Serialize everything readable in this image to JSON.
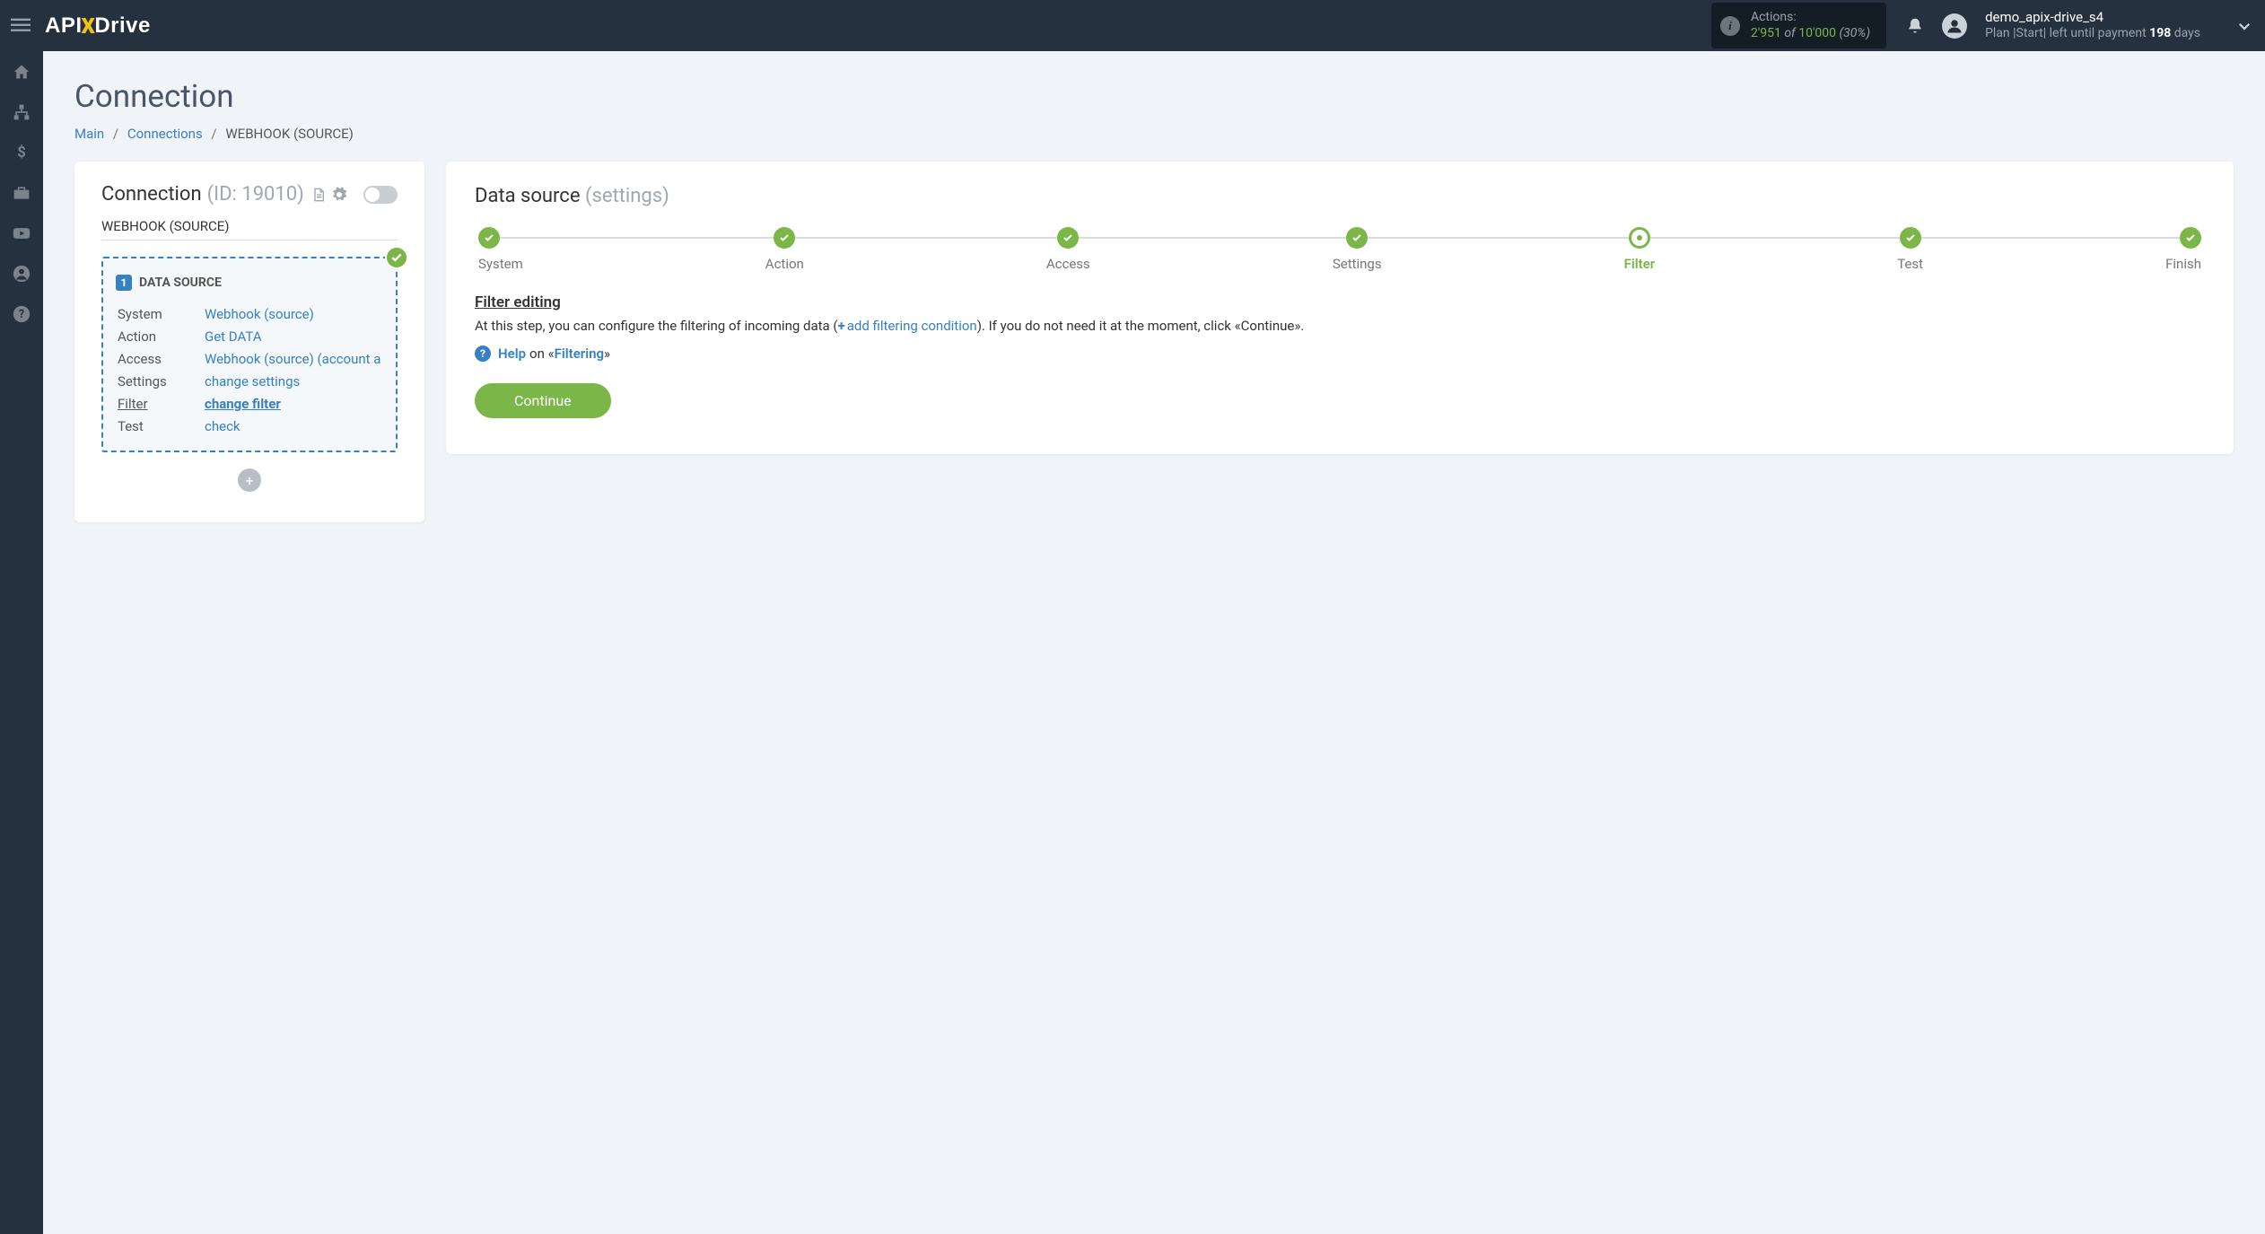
{
  "header": {
    "actions_label": "Actions:",
    "actions_used": "2'951",
    "actions_of": " of ",
    "actions_total": "10'000",
    "actions_pct": " (30%)",
    "username": "demo_apix-drive_s4",
    "plan_prefix": "Plan |Start| left until payment ",
    "plan_days": "198",
    "plan_suffix": " days"
  },
  "page": {
    "title": "Connection",
    "crumb_main": "Main",
    "crumb_conn": "Connections",
    "crumb_current": "WEBHOOK (SOURCE)"
  },
  "conn_card": {
    "title": "Connection",
    "id_label": "(ID: 19010)",
    "subtitle": "WEBHOOK (SOURCE)",
    "box_title": "DATA SOURCE",
    "rows": [
      {
        "label": "System",
        "value": "Webhook (source)"
      },
      {
        "label": "Action",
        "value": "Get DATA"
      },
      {
        "label": "Access",
        "value": "Webhook (source) (account a"
      },
      {
        "label": "Settings",
        "value": "change settings"
      },
      {
        "label": "Filter",
        "value": "change filter"
      },
      {
        "label": "Test",
        "value": "check"
      }
    ],
    "active_row_index": 4
  },
  "ds": {
    "title": "Data source",
    "title_suffix": "(settings)",
    "steps": [
      "System",
      "Action",
      "Access",
      "Settings",
      "Filter",
      "Test",
      "Finish"
    ],
    "current_step_index": 4,
    "section_title": "Filter editing",
    "text_before": "At this step, you can configure the filtering of incoming data (",
    "add_link": "add filtering condition",
    "text_after": "). If you do not need it at the moment, click «Continue».",
    "help_word": "Help",
    "help_on": "on «",
    "help_topic": "Filtering",
    "help_close": "»",
    "continue": "Continue"
  }
}
